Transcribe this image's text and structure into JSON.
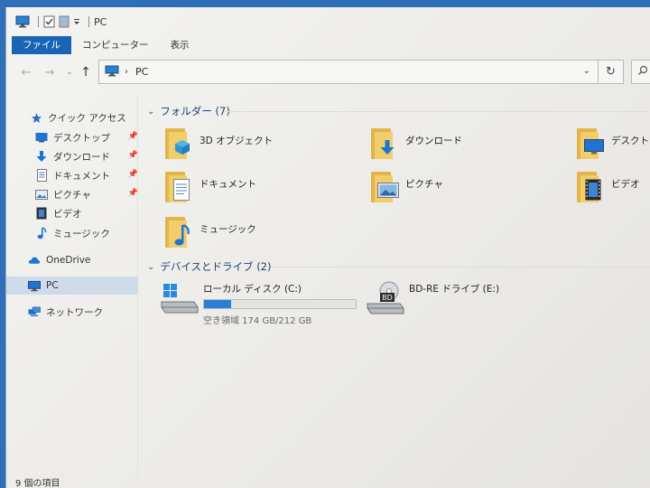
{
  "window": {
    "title": "PC",
    "status": "9 個の項目"
  },
  "ribbon": {
    "tabs": [
      {
        "label": "ファイル",
        "active": true
      },
      {
        "label": "コンピューター",
        "active": false
      },
      {
        "label": "表示",
        "active": false
      }
    ]
  },
  "address": {
    "location": "PC"
  },
  "sidebar": {
    "items": [
      {
        "label": "クイック アクセス",
        "icon": "star-icon",
        "pinned": false
      },
      {
        "label": "デスクトップ",
        "icon": "desktop-icon",
        "pinned": true
      },
      {
        "label": "ダウンロード",
        "icon": "download-arrow-icon",
        "pinned": true
      },
      {
        "label": "ドキュメント",
        "icon": "document-icon",
        "pinned": true
      },
      {
        "label": "ピクチャ",
        "icon": "picture-icon",
        "pinned": true
      },
      {
        "label": "ビデオ",
        "icon": "video-icon",
        "pinned": false
      },
      {
        "label": "ミュージック",
        "icon": "music-note-icon",
        "pinned": false
      },
      {
        "label": "OneDrive",
        "icon": "cloud-icon",
        "pinned": false
      },
      {
        "label": "PC",
        "icon": "monitor-icon",
        "pinned": false,
        "selected": true
      },
      {
        "label": "ネットワーク",
        "icon": "network-icon",
        "pinned": false
      }
    ]
  },
  "folders_group": {
    "title": "フォルダー (7)",
    "items": [
      {
        "label": "3D オブジェクト",
        "icon": "3d-objects-folder-icon"
      },
      {
        "label": "ダウンロード",
        "icon": "downloads-folder-icon"
      },
      {
        "label": "デスクトップ",
        "icon": "desktop-folder-icon"
      },
      {
        "label": "ドキュメント",
        "icon": "documents-folder-icon"
      },
      {
        "label": "ピクチャ",
        "icon": "pictures-folder-icon"
      },
      {
        "label": "ビデオ",
        "icon": "videos-folder-icon"
      },
      {
        "label": "ミュージック",
        "icon": "music-folder-icon"
      }
    ]
  },
  "drives_group": {
    "title": "デバイスとドライブ (2)",
    "items": [
      {
        "label": "ローカル ディスク (C:)",
        "icon": "local-disk-icon",
        "free_text": "空き領域 174 GB/212 GB",
        "used_fraction": 0.18
      },
      {
        "label": "BD-RE ドライブ (E:)",
        "icon": "bd-drive-icon"
      }
    ]
  },
  "colors": {
    "accent": "#1a64b5",
    "folder": "#f2cd6b",
    "progress": "#2a7fd6"
  }
}
